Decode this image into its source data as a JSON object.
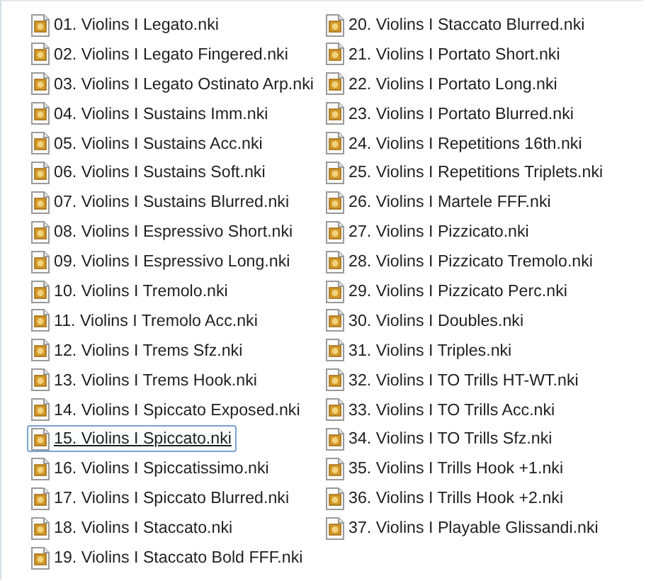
{
  "files": [
    {
      "name": "01. Violins I Legato.nki",
      "focused": false
    },
    {
      "name": "02. Violins I Legato Fingered.nki",
      "focused": false
    },
    {
      "name": "03. Violins I Legato Ostinato Arp.nki",
      "focused": false
    },
    {
      "name": "04. Violins I Sustains Imm.nki",
      "focused": false
    },
    {
      "name": "05. Violins I Sustains Acc.nki",
      "focused": false
    },
    {
      "name": "06. Violins I Sustains Soft.nki",
      "focused": false
    },
    {
      "name": "07. Violins I Sustains Blurred.nki",
      "focused": false
    },
    {
      "name": "08. Violins I Espressivo Short.nki",
      "focused": false
    },
    {
      "name": "09. Violins I Espressivo Long.nki",
      "focused": false
    },
    {
      "name": "10. Violins I Tremolo.nki",
      "focused": false
    },
    {
      "name": "11. Violins I Tremolo Acc.nki",
      "focused": false
    },
    {
      "name": "12. Violins I Trems Sfz.nki",
      "focused": false
    },
    {
      "name": "13. Violins I Trems Hook.nki",
      "focused": false
    },
    {
      "name": "14. Violins I Spiccato Exposed.nki",
      "focused": false
    },
    {
      "name": "15. Violins I Spiccato.nki",
      "focused": true
    },
    {
      "name": "16. Violins I Spiccatissimo.nki",
      "focused": false
    },
    {
      "name": "17. Violins I Spiccato Blurred.nki",
      "focused": false
    },
    {
      "name": "18. Violins I Staccato.nki",
      "focused": false
    },
    {
      "name": "19. Violins I Staccato Bold FFF.nki",
      "focused": false
    },
    {
      "name": "20. Violins I Staccato Blurred.nki",
      "focused": false
    },
    {
      "name": "21. Violins I Portato Short.nki",
      "focused": false
    },
    {
      "name": "22. Violins I Portato Long.nki",
      "focused": false
    },
    {
      "name": "23. Violins I Portato Blurred.nki",
      "focused": false
    },
    {
      "name": "24. Violins I Repetitions 16th.nki",
      "focused": false
    },
    {
      "name": "25. Violins I Repetitions Triplets.nki",
      "focused": false
    },
    {
      "name": "26. Violins I Martele FFF.nki",
      "focused": false
    },
    {
      "name": "27. Violins I Pizzicato.nki",
      "focused": false
    },
    {
      "name": "28. Violins I Pizzicato Tremolo.nki",
      "focused": false
    },
    {
      "name": "29. Violins I Pizzicato Perc.nki",
      "focused": false
    },
    {
      "name": "30. Violins I Doubles.nki",
      "focused": false
    },
    {
      "name": "31. Violins I Triples.nki",
      "focused": false
    },
    {
      "name": "32. Violins I TO Trills HT-WT.nki",
      "focused": false
    },
    {
      "name": "33. Violins I TO Trills Acc.nki",
      "focused": false
    },
    {
      "name": "34. Violins I TO Trills Sfz.nki",
      "focused": false
    },
    {
      "name": "35. Violins I Trills Hook +1.nki",
      "focused": false
    },
    {
      "name": "36. Violins I Trills Hook +2.nki",
      "focused": false
    },
    {
      "name": "37. Violins I Playable Glissandi.nki",
      "focused": false
    }
  ]
}
